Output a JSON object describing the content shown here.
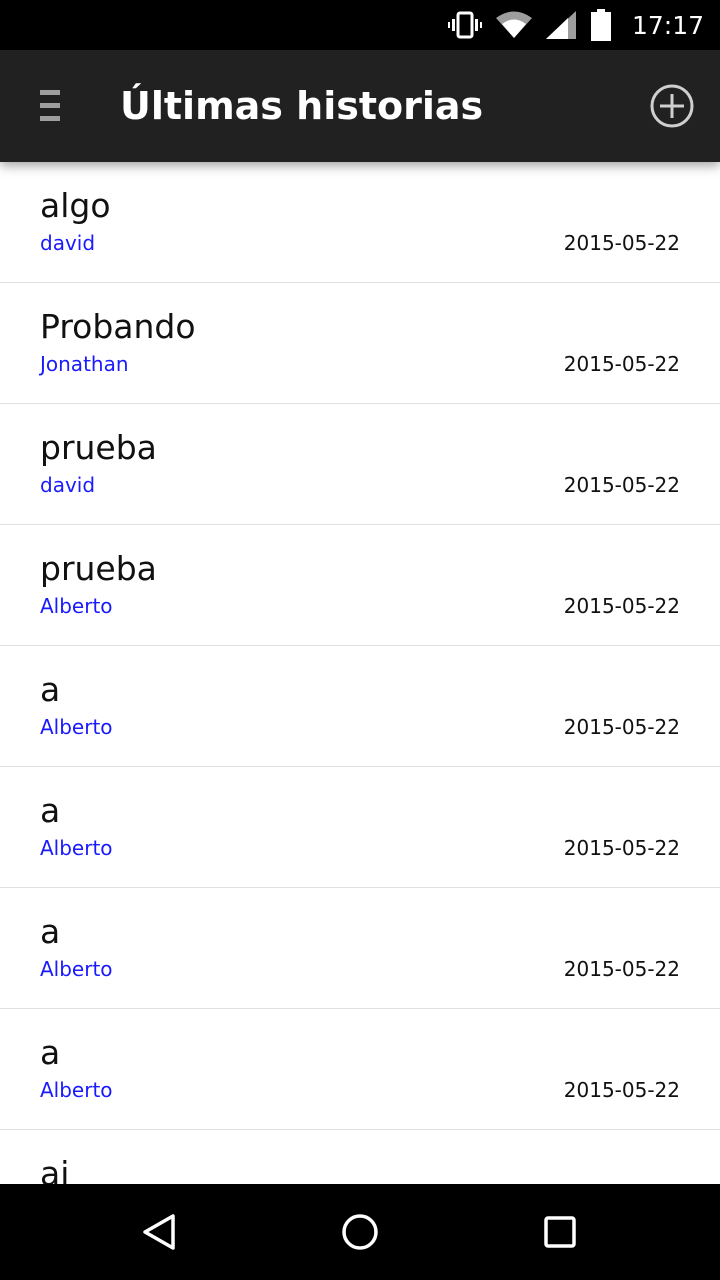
{
  "status_bar": {
    "time": "17:17",
    "icons": [
      "vibrate-icon",
      "wifi-icon",
      "signal-icon",
      "battery-icon"
    ]
  },
  "app_bar": {
    "title": "Últimas historias",
    "menu_icon": "hamburger-menu-icon",
    "add_icon": "add-circle-icon"
  },
  "stories": [
    {
      "title": "algo",
      "author": "david",
      "date": "2015-05-22"
    },
    {
      "title": "Probando",
      "author": "Jonathan",
      "date": "2015-05-22"
    },
    {
      "title": "prueba",
      "author": "david",
      "date": "2015-05-22"
    },
    {
      "title": "prueba",
      "author": "Alberto",
      "date": "2015-05-22"
    },
    {
      "title": "a",
      "author": "Alberto",
      "date": "2015-05-22"
    },
    {
      "title": "a",
      "author": "Alberto",
      "date": "2015-05-22"
    },
    {
      "title": "a",
      "author": "Alberto",
      "date": "2015-05-22"
    },
    {
      "title": "a",
      "author": "Alberto",
      "date": "2015-05-22"
    },
    {
      "title": "aj",
      "author": "",
      "date": ""
    }
  ],
  "nav_bar": {
    "icons": [
      "back-icon",
      "home-icon",
      "recents-icon"
    ]
  },
  "colors": {
    "app_bar_bg": "#212121",
    "author_link": "#1a1aff",
    "divider": "#e0e0e0"
  }
}
